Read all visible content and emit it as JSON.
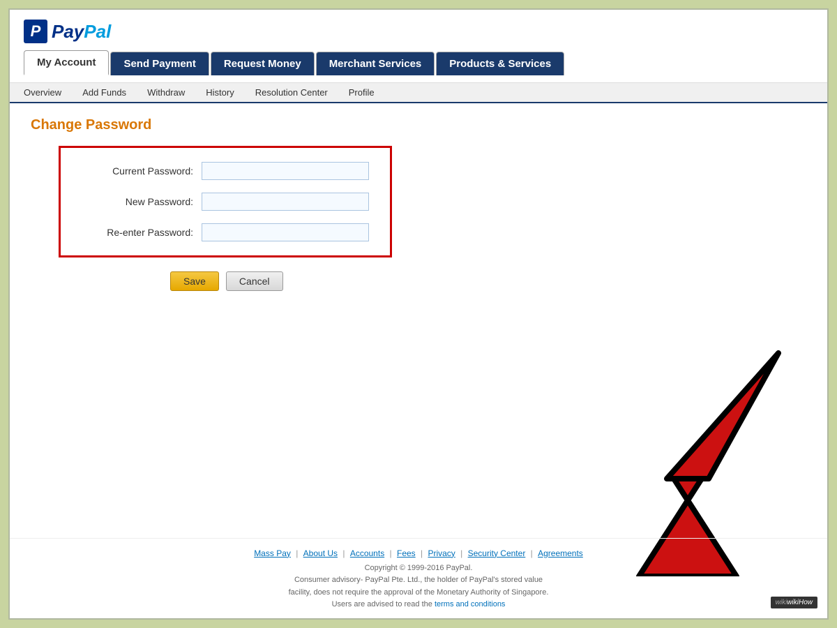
{
  "logo": {
    "p_letter": "P",
    "name_part1": "Pay",
    "name_part2": "Pal"
  },
  "nav": {
    "tabs": [
      {
        "id": "my-account",
        "label": "My Account",
        "active": true
      },
      {
        "id": "send-payment",
        "label": "Send Payment",
        "active": false
      },
      {
        "id": "request-money",
        "label": "Request Money",
        "active": false
      },
      {
        "id": "merchant-services",
        "label": "Merchant Services",
        "active": false
      },
      {
        "id": "products-services",
        "label": "Products & Services",
        "active": false
      }
    ],
    "sub_links": [
      "Overview",
      "Add Funds",
      "Withdraw",
      "History",
      "Resolution Center",
      "Profile"
    ]
  },
  "page": {
    "title": "Change Password",
    "form": {
      "current_password_label": "Current Password:",
      "new_password_label": "New Password:",
      "reenter_password_label": "Re-enter Password:",
      "save_button": "Save",
      "cancel_button": "Cancel"
    }
  },
  "footer": {
    "links": [
      "Mass Pay",
      "About Us",
      "Accounts",
      "Fees",
      "Privacy",
      "Security Center",
      "Agreements"
    ],
    "copyright": "Copyright © 1999-2016 PayPal.",
    "advisory1": "Consumer advisory- PayPal Pte. Ltd., the holder of PayPal's stored value",
    "advisory2": "facility, does not require the approval of the Monetary Authority of Singapore.",
    "advisory3": "Users are advised to read the",
    "terms_link": "terms and conditions",
    "wikihow": "wikiHow"
  }
}
